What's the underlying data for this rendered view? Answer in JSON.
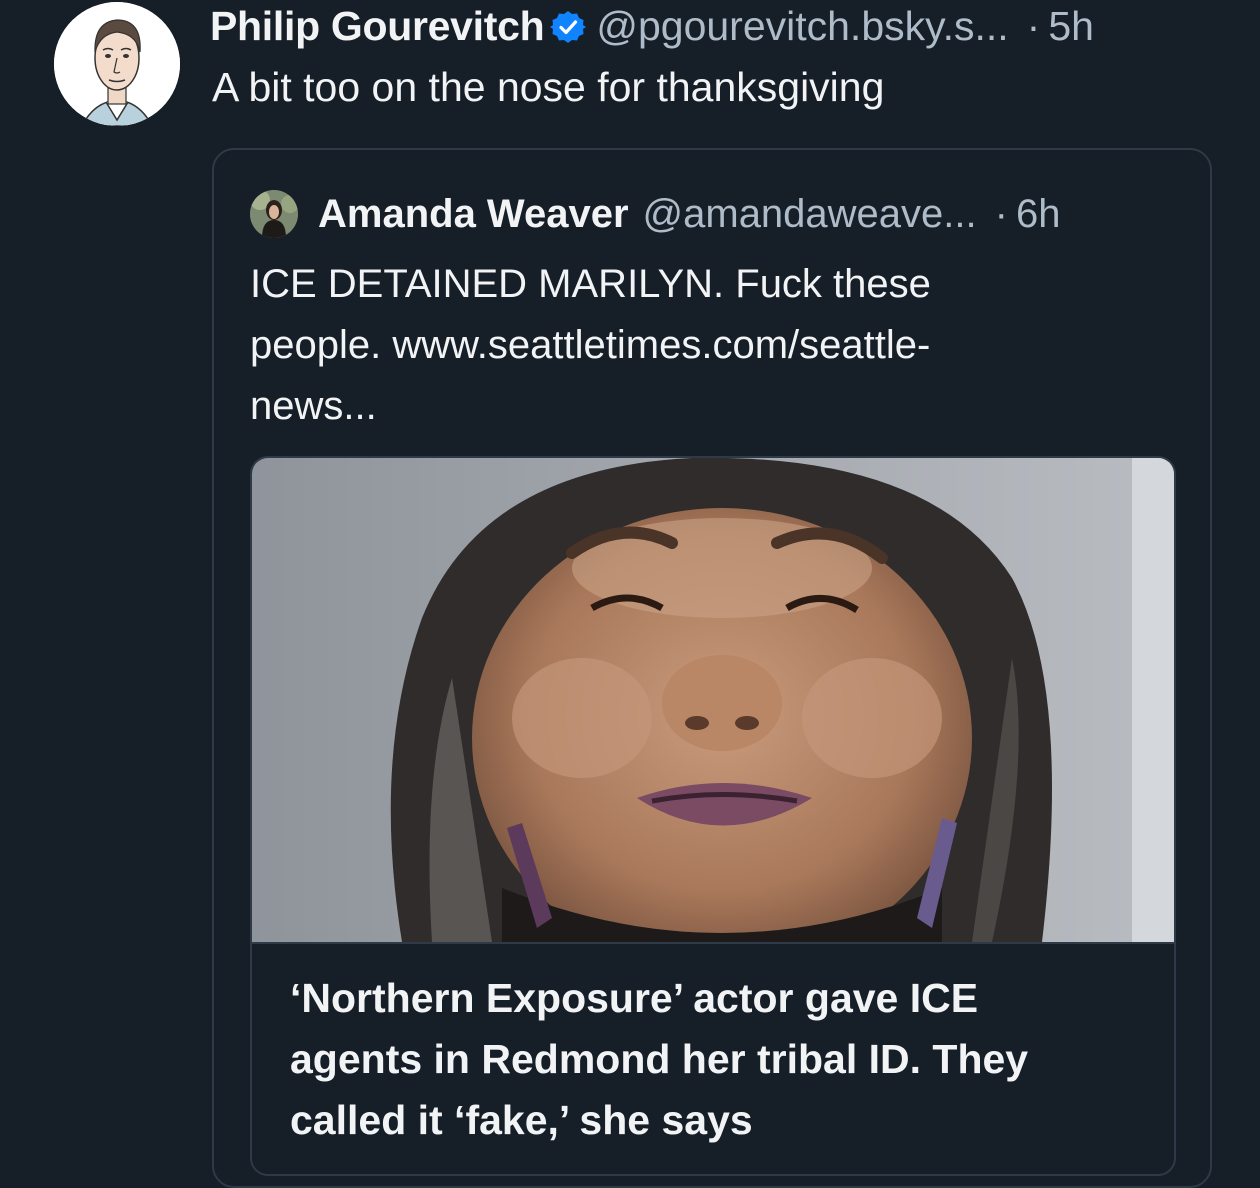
{
  "post": {
    "author": {
      "display_name": "Philip Gourevitch",
      "handle": "@pgourevitch.bsky.s...",
      "verified_icon": "verified-badge-icon",
      "avatar_icon": "caricature-avatar"
    },
    "separator": "·",
    "time": "5h",
    "text": "A bit too on the nose for thanksgiving"
  },
  "quote": {
    "author": {
      "display_name": "Amanda Weaver",
      "handle": "@amandaweave...",
      "avatar_icon": "photo-avatar"
    },
    "separator": "·",
    "time": "6h",
    "text_lines": [
      "ICE DETAINED MARILYN. Fuck these",
      "people. www.seattletimes.com/seattle-",
      "news..."
    ],
    "link_card": {
      "image": "photo-of-smiling-woman",
      "title_lines": [
        "‘Northern Exposure’ actor gave ICE",
        "agents in Redmond her tribal ID. They",
        "called it ‘fake,’ she says"
      ]
    }
  },
  "colors": {
    "background": "#161e27",
    "text_primary": "#f1f3f5",
    "text_secondary": "#aebbc9",
    "border": "#2e3a48",
    "verified_blue": "#1083fe"
  }
}
